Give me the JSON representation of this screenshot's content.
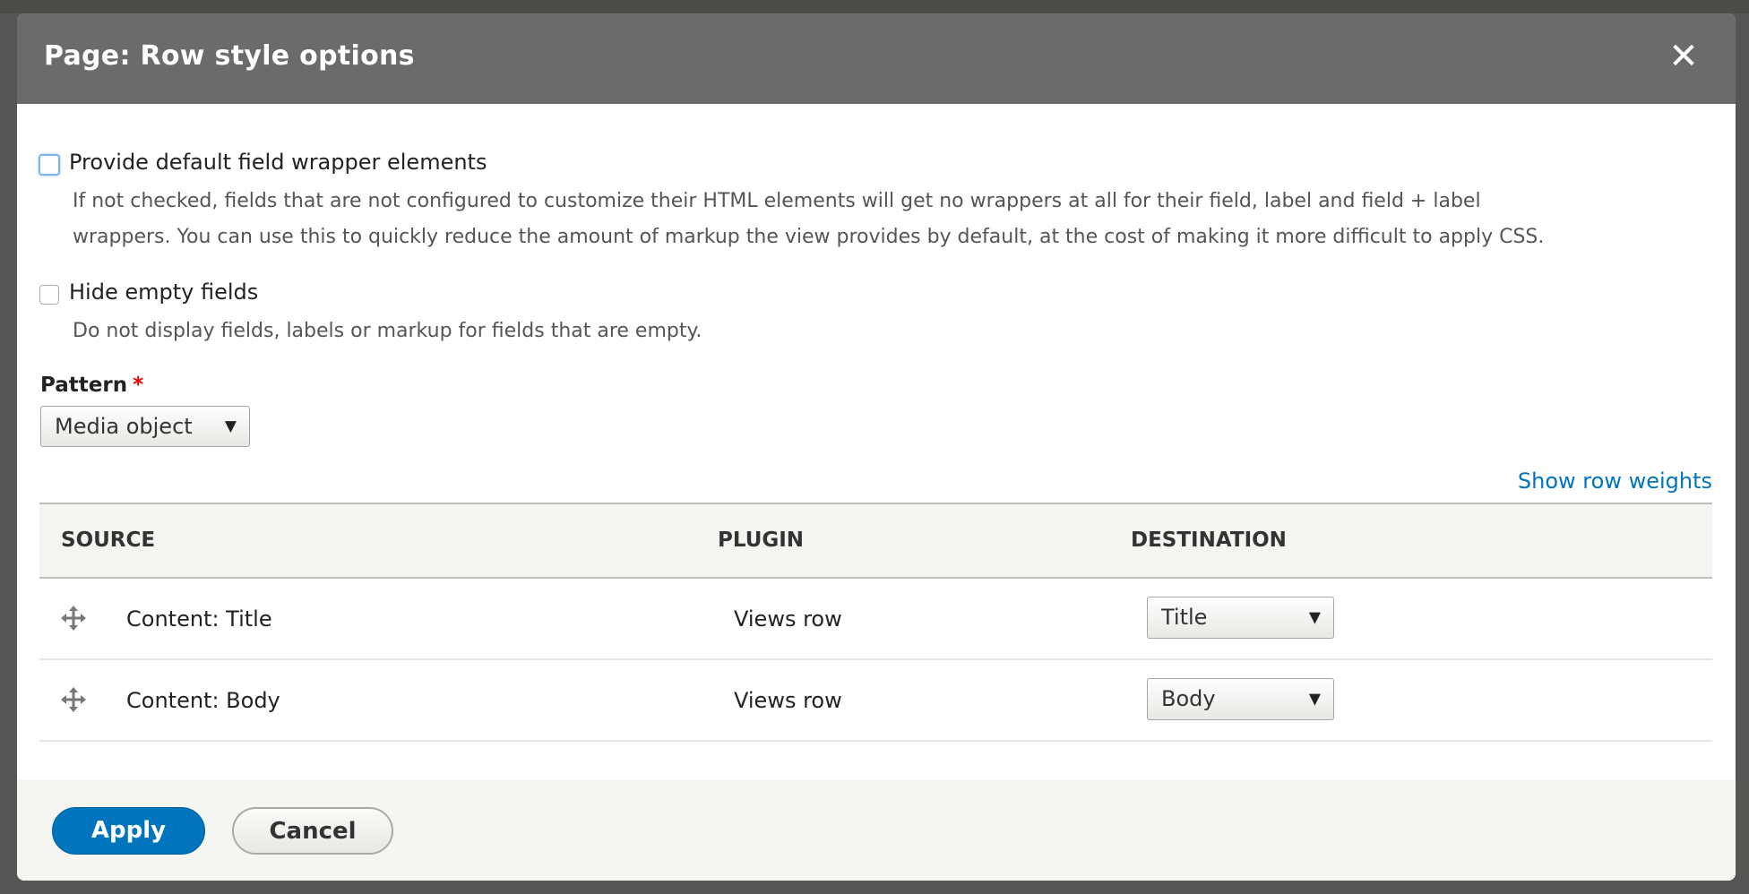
{
  "dialog": {
    "title": "Page: Row style options",
    "close_icon": "close-icon"
  },
  "options": [
    {
      "label": "Provide default field wrapper elements",
      "checked": false,
      "focused": true,
      "description_lines": [
        "If not checked, fields that are not configured to customize their HTML elements will get no wrappers at all for their field, label and field + label",
        "wrappers. You can use this to quickly reduce the amount of markup the view provides by default, at the cost of making it more difficult to apply CSS."
      ]
    },
    {
      "label": "Hide empty fields",
      "checked": false,
      "description_lines": [
        "Do not display fields, labels or markup for fields that are empty."
      ]
    }
  ],
  "pattern": {
    "label": "Pattern",
    "required_marker": "*",
    "value": "Media object"
  },
  "show_row_weights": "Show row weights",
  "table": {
    "headers": [
      "SOURCE",
      "PLUGIN",
      "DESTINATION"
    ],
    "rows": [
      {
        "source": "Content: Title",
        "plugin": "Views row",
        "destination": "Title"
      },
      {
        "source": "Content: Body",
        "plugin": "Views row",
        "destination": "Body"
      }
    ]
  },
  "buttons": {
    "apply": "Apply",
    "cancel": "Cancel"
  },
  "colors": {
    "header_bg": "#6b6b6b",
    "primary": "#0074bd",
    "link": "#0074bd"
  }
}
